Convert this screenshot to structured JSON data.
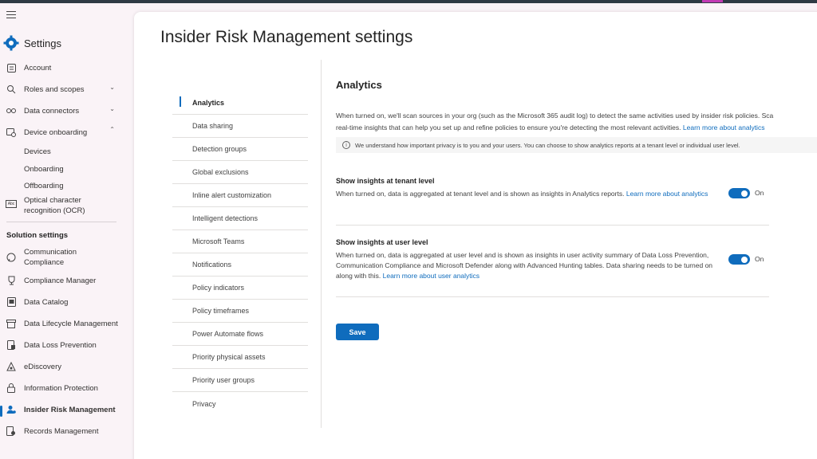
{
  "nav": {
    "title": "Settings",
    "items": [
      {
        "label": "Account",
        "icon": "account-icon"
      },
      {
        "label": "Roles and scopes",
        "icon": "roles-icon",
        "chevron": "v"
      },
      {
        "label": "Data connectors",
        "icon": "connectors-icon",
        "chevron": "v"
      },
      {
        "label": "Device onboarding",
        "icon": "device-icon",
        "chevron": "^"
      }
    ],
    "device_subitems": [
      "Devices",
      "Onboarding",
      "Offboarding"
    ],
    "ocr_label": "Optical character recognition (OCR)",
    "ocr_icon_text": "Abc",
    "solution_heading": "Solution settings",
    "solution_items": [
      {
        "label": "Communication Compliance",
        "icon": "chat-icon"
      },
      {
        "label": "Compliance Manager",
        "icon": "trophy-icon"
      },
      {
        "label": "Data Catalog",
        "icon": "catalog-icon"
      },
      {
        "label": "Data Lifecycle Management",
        "icon": "archive-icon"
      },
      {
        "label": "Data Loss Prevention",
        "icon": "shield-doc-icon"
      },
      {
        "label": "eDiscovery",
        "icon": "ediscovery-icon"
      },
      {
        "label": "Information Protection",
        "icon": "lock-icon"
      },
      {
        "label": "Insider Risk Management",
        "icon": "people-risk-icon"
      },
      {
        "label": "Records Management",
        "icon": "records-icon"
      }
    ]
  },
  "page": {
    "title": "Insider Risk Management settings"
  },
  "subnav": [
    "Analytics",
    "Data sharing",
    "Detection groups",
    "Global exclusions",
    "Inline alert customization",
    "Intelligent detections",
    "Microsoft Teams",
    "Notifications",
    "Policy indicators",
    "Policy timeframes",
    "Power Automate flows",
    "Priority physical assets",
    "Priority user groups",
    "Privacy"
  ],
  "analytics": {
    "title": "Analytics",
    "desc_line1": "When turned on, we'll scan sources in your org (such as the Microsoft 365 audit log) to detect the same activities used by insider risk policies. Sca",
    "desc_line2": "real-time insights that can help you set up and refine policies to ensure you're detecting the most relevant activities.",
    "desc_link": "Learn more about analytics",
    "info": "We understand how important privacy is to you and your users. You can choose to show analytics reports at a tenant level or individual user level.",
    "tenant": {
      "title": "Show insights at tenant level",
      "desc": "When turned on, data is aggregated at tenant level and is shown as insights in Analytics reports.",
      "link": "Learn more about analytics",
      "toggle_label": "On"
    },
    "user": {
      "title": "Show insights at user level",
      "desc": "When turned on, data is aggregated at user level and is shown as insights in user activity summary of Data Loss Prevention, Communication Compliance and Microsoft Defender along with Advanced Hunting tables. Data sharing needs to be turned on along with this.",
      "link": "Learn more about user analytics",
      "toggle_label": "On"
    },
    "save_label": "Save"
  },
  "colors": {
    "accent": "#0f6cbd",
    "nav_bg": "#faf3f7"
  }
}
